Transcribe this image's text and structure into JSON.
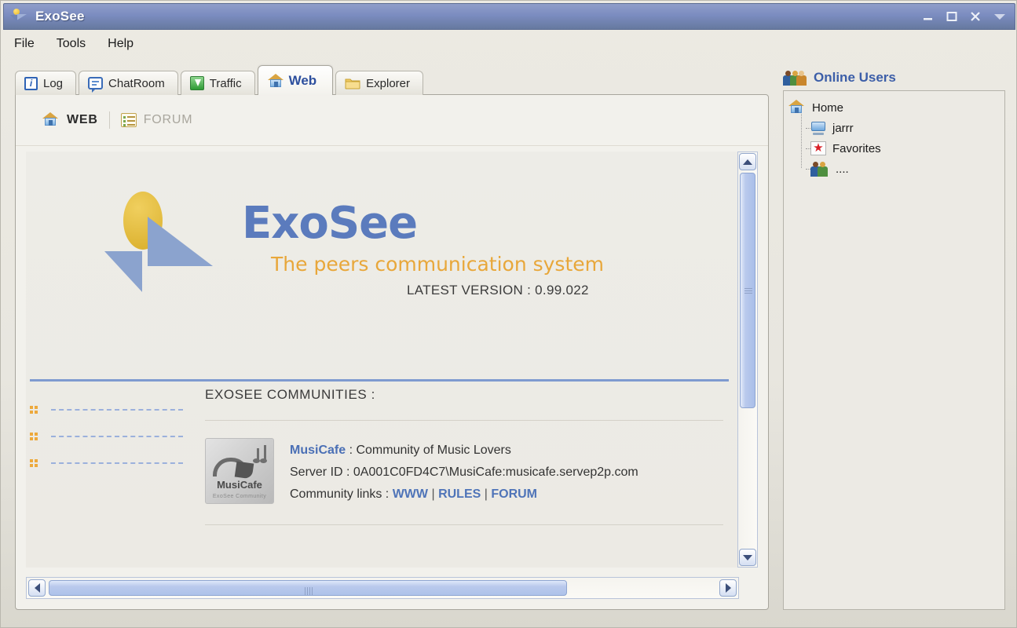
{
  "window": {
    "title": "ExoSee",
    "app_icon": "exosee-logo-icon",
    "controls": {
      "minimize": "minimize-icon",
      "maximize": "maximize-icon",
      "close": "close-icon",
      "dropdown": "chevron-down-icon"
    }
  },
  "menubar": {
    "items": [
      {
        "label": "File"
      },
      {
        "label": "Tools"
      },
      {
        "label": "Help"
      }
    ]
  },
  "tabs": [
    {
      "label": "Log",
      "icon": "info-icon",
      "active": false
    },
    {
      "label": "ChatRoom",
      "icon": "speech-bubble-icon",
      "active": false
    },
    {
      "label": "Traffic",
      "icon": "down-arrow-icon",
      "active": false
    },
    {
      "label": "Web",
      "icon": "house-icon",
      "active": true
    },
    {
      "label": "Explorer",
      "icon": "folder-icon",
      "active": false
    }
  ],
  "subnav": {
    "items": [
      {
        "label": "WEB",
        "icon": "house-icon",
        "active": true
      },
      {
        "label": "FORUM",
        "icon": "list-icon",
        "active": false
      }
    ]
  },
  "web_page": {
    "logo": {
      "wordmark": "ExoSee",
      "tagline": "The peers communication system",
      "version_line": "LATEST VERSION : 0.99.022"
    },
    "placeholder_rows": [
      {
        "bullet": "orange-dots-icon"
      },
      {
        "bullet": "orange-dots-icon"
      },
      {
        "bullet": "orange-dots-icon"
      }
    ],
    "communities": {
      "heading": "EXOSEE COMMUNITIES :",
      "entries": [
        {
          "logo_name": "MusiCafe",
          "logo_subtitle": "ExoSee Community",
          "name": "MusiCafe",
          "name_separator": " : ",
          "description": "Community of Music Lovers",
          "server_id_label": "Server ID : ",
          "server_id": "0A001C0FD4C7\\MusiCafe:musicafe.servep2p.com",
          "links_label": "Community links : ",
          "links": [
            "WWW",
            "RULES",
            "FORUM"
          ],
          "link_separator": " | "
        }
      ]
    }
  },
  "scrollbars": {
    "vertical": {
      "up": "scroll-up-icon",
      "down": "scroll-down-icon",
      "thumb_top_percent": 5,
      "thumb_height_percent": 57
    },
    "horizontal": {
      "left": "scroll-left-icon",
      "right": "scroll-right-icon",
      "thumb_left_percent": 3,
      "thumb_width_percent": 73
    }
  },
  "right_panel": {
    "title": "Online Users",
    "title_icon": "users-icon",
    "tree": [
      {
        "label": "Home",
        "icon": "house-icon",
        "level": 0
      },
      {
        "label": "jarrr",
        "icon": "monitor-icon",
        "level": 1
      },
      {
        "label": "Favorites",
        "icon": "star-icon",
        "level": 1
      },
      {
        "label": "....",
        "icon": "users-icon",
        "level": 1
      }
    ]
  },
  "colors": {
    "titlebar": "#7b8cc0",
    "accent_blue": "#5b7bbd",
    "accent_orange": "#e8a73a",
    "link_blue": "#4f74b8",
    "divider_blue": "#7e9ad0",
    "panel_bg": "#eceae4"
  }
}
